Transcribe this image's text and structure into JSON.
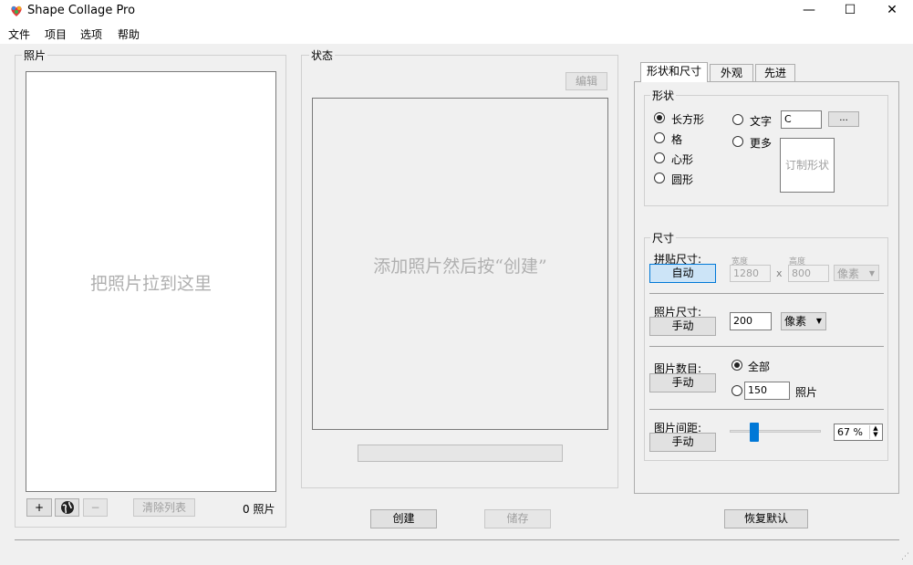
{
  "window": {
    "title": "Shape Collage Pro",
    "minimize": "—",
    "maximize": "☐",
    "close": "✕"
  },
  "menu": [
    "文件",
    "项目",
    "选项",
    "帮助"
  ],
  "photos": {
    "group_label": "照片",
    "drop_hint": "把照片拉到这里",
    "add_label": "+",
    "remove_label": "−",
    "clear_label": "清除列表",
    "count": "0 照片"
  },
  "status": {
    "group_label": "状态",
    "edit_label": "编辑",
    "preview_hint": "添加照片然后按“创建”"
  },
  "actions": {
    "create": "创建",
    "save": "储存",
    "reset": "恢复默认"
  },
  "tabs": [
    {
      "label": "形状和尺寸",
      "active": true
    },
    {
      "label": "外观",
      "active": false
    },
    {
      "label": "先进",
      "active": false
    }
  ],
  "shape": {
    "group_label": "形状",
    "options": [
      {
        "label": "长方形",
        "selected": true
      },
      {
        "label": "格",
        "selected": false
      },
      {
        "label": "心形",
        "selected": false
      },
      {
        "label": "圆形",
        "selected": false
      },
      {
        "label": "文字",
        "selected": false
      },
      {
        "label": "更多",
        "selected": false
      }
    ],
    "text_value": "C",
    "ellipsis_label": "...",
    "custom_label": "订制形状"
  },
  "size": {
    "group_label": "尺寸",
    "collage": {
      "label": "拼贴尺寸:",
      "button": "自动",
      "width_label": "宽度",
      "height_label": "高度",
      "width": "1280",
      "height": "800",
      "x": "x",
      "unit": "像素"
    },
    "photo": {
      "label": "照片尺寸:",
      "button": "手动",
      "value": "200",
      "unit": "像素"
    },
    "count": {
      "label": "图片数目:",
      "button": "手动",
      "all_label": "全部",
      "all_selected": true,
      "value": "150",
      "value_unit": "照片"
    },
    "spacing": {
      "label": "图片间距:",
      "button": "手动",
      "value": "67 %",
      "slider_percent": 0.2
    }
  },
  "icons": {
    "globe": "globe-icon",
    "dropdown": "chevron-down-icon",
    "spin": "spin-arrows-icon"
  }
}
